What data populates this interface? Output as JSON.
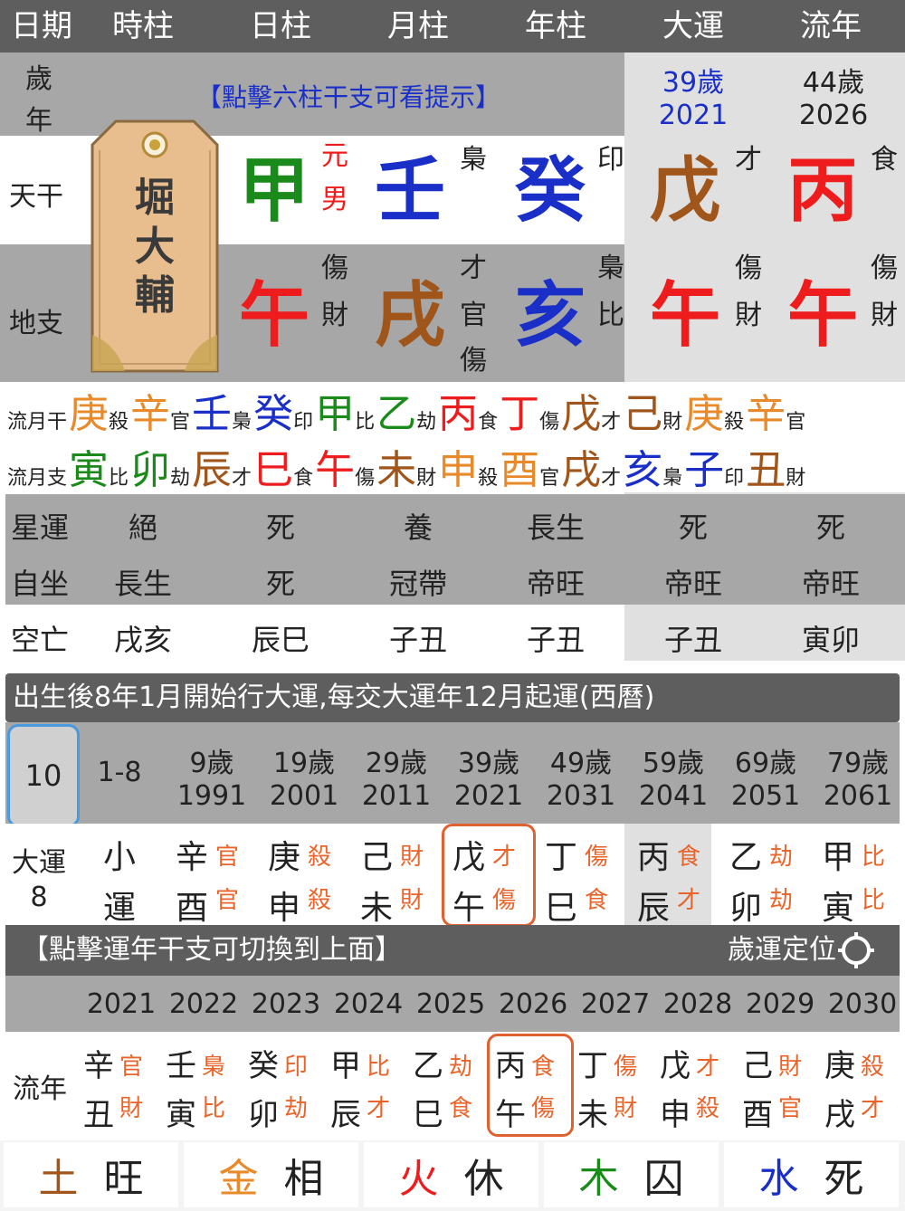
{
  "header": {
    "cols": [
      "日期",
      "時柱",
      "日柱",
      "月柱",
      "年柱",
      "大運",
      "流年"
    ]
  },
  "age_row": {
    "label_top": "歲",
    "label_bottom": "年",
    "hint": "【點擊六柱干支可看提示】",
    "dayun_age": "39歲",
    "dayun_year": "2021",
    "liunian_age": "44歲",
    "liunian_year": "2026"
  },
  "tag": {
    "chars": [
      "堀",
      "大",
      "輔"
    ]
  },
  "tiangan": {
    "label": "天干",
    "day": {
      "char": "甲",
      "color": "#1a8a1a"
    },
    "gender": [
      "元",
      "男"
    ],
    "month": {
      "char": "壬",
      "color": "#1a2fc8"
    },
    "month_ten": "梟",
    "year": {
      "char": "癸",
      "color": "#1a2fc8"
    },
    "year_ten": "印",
    "dayun": {
      "char": "戊",
      "color": "#a0551a"
    },
    "dayun_ten": "才",
    "liunian": {
      "char": "丙",
      "color": "#ee1c1c"
    },
    "liunian_ten": "食"
  },
  "dizhi": {
    "label": "地支",
    "day": {
      "char": "午",
      "color": "#ee1c1c",
      "hidden": [
        "傷",
        "財"
      ]
    },
    "month": {
      "char": "戌",
      "color": "#a0551a",
      "hidden": [
        "才",
        "官",
        "傷"
      ]
    },
    "year": {
      "char": "亥",
      "color": "#1a2fc8",
      "hidden": [
        "梟",
        "比"
      ]
    },
    "dayun": {
      "char": "午",
      "color": "#ee1c1c",
      "hidden": [
        "傷",
        "財"
      ]
    },
    "liunian": {
      "char": "午",
      "color": "#ee1c1c",
      "hidden": [
        "傷",
        "財"
      ]
    }
  },
  "liuyue_gan": {
    "label": "流月干",
    "items": [
      {
        "g": "庚",
        "t": "殺",
        "c": "#e8892a"
      },
      {
        "g": "辛",
        "t": "官",
        "c": "#e8892a"
      },
      {
        "g": "壬",
        "t": "梟",
        "c": "#1a2fc8"
      },
      {
        "g": "癸",
        "t": "印",
        "c": "#1a2fc8"
      },
      {
        "g": "甲",
        "t": "比",
        "c": "#1a8a1a"
      },
      {
        "g": "乙",
        "t": "劫",
        "c": "#1a8a1a"
      },
      {
        "g": "丙",
        "t": "食",
        "c": "#ee1c1c"
      },
      {
        "g": "丁",
        "t": "傷",
        "c": "#ee1c1c"
      },
      {
        "g": "戊",
        "t": "才",
        "c": "#a0551a"
      },
      {
        "g": "己",
        "t": "財",
        "c": "#a0551a"
      },
      {
        "g": "庚",
        "t": "殺",
        "c": "#e8892a"
      },
      {
        "g": "辛",
        "t": "官",
        "c": "#e8892a"
      }
    ]
  },
  "liuyue_zhi": {
    "label": "流月支",
    "items": [
      {
        "g": "寅",
        "t": "比",
        "c": "#1a8a1a"
      },
      {
        "g": "卯",
        "t": "劫",
        "c": "#1a8a1a"
      },
      {
        "g": "辰",
        "t": "才",
        "c": "#a0551a"
      },
      {
        "g": "巳",
        "t": "食",
        "c": "#ee1c1c"
      },
      {
        "g": "午",
        "t": "傷",
        "c": "#ee1c1c"
      },
      {
        "g": "未",
        "t": "財",
        "c": "#a0551a"
      },
      {
        "g": "申",
        "t": "殺",
        "c": "#e8892a"
      },
      {
        "g": "酉",
        "t": "官",
        "c": "#e8892a"
      },
      {
        "g": "戌",
        "t": "才",
        "c": "#a0551a"
      },
      {
        "g": "亥",
        "t": "梟",
        "c": "#1a2fc8"
      },
      {
        "g": "子",
        "t": "印",
        "c": "#1a2fc8"
      },
      {
        "g": "丑",
        "t": "財",
        "c": "#a0551a"
      }
    ]
  },
  "xingyun": {
    "label": "星運",
    "vals": [
      "絕",
      "死",
      "養",
      "長生",
      "死",
      "死"
    ]
  },
  "zizuo": {
    "label": "自坐",
    "vals": [
      "長生",
      "死",
      "冠帶",
      "帝旺",
      "帝旺",
      "帝旺"
    ]
  },
  "kongwang": {
    "label": "空亡",
    "vals": [
      "戌亥",
      "辰巳",
      "子丑",
      "子丑",
      "子丑",
      "寅卯"
    ]
  },
  "dayun_bar": {
    "text": "出生後8年1月開始行大運,每交大運年12月起運(西曆)"
  },
  "dayun_ages": {
    "selected": "10",
    "range": "1-8",
    "cols": [
      {
        "age": "9歲",
        "year": "1991"
      },
      {
        "age": "19歲",
        "year": "2001"
      },
      {
        "age": "29歲",
        "year": "2011"
      },
      {
        "age": "39歲",
        "year": "2021"
      },
      {
        "age": "49歲",
        "year": "2031"
      },
      {
        "age": "59歲",
        "year": "2041"
      },
      {
        "age": "69歲",
        "year": "2051"
      },
      {
        "age": "79歲",
        "year": "2061"
      }
    ]
  },
  "dayun_pillars": {
    "label": "大運",
    "label_num": "8",
    "small": [
      "小",
      "運"
    ],
    "cols": [
      {
        "g": "辛",
        "gt": "官",
        "z": "酉",
        "zt": "官"
      },
      {
        "g": "庚",
        "gt": "殺",
        "z": "申",
        "zt": "殺"
      },
      {
        "g": "己",
        "gt": "財",
        "z": "未",
        "zt": "財"
      },
      {
        "g": "戊",
        "gt": "才",
        "z": "午",
        "zt": "傷"
      },
      {
        "g": "丁",
        "gt": "傷",
        "z": "巳",
        "zt": "食"
      },
      {
        "g": "丙",
        "gt": "食",
        "z": "辰",
        "zt": "才"
      },
      {
        "g": "乙",
        "gt": "劫",
        "z": "卯",
        "zt": "劫"
      },
      {
        "g": "甲",
        "gt": "比",
        "z": "寅",
        "zt": "比"
      }
    ]
  },
  "switch_bar": {
    "text": "【點擊運年干支可切換到上面】",
    "locate": "歲運定位"
  },
  "liunian_years": [
    "2021",
    "2022",
    "2023",
    "2024",
    "2025",
    "2026",
    "2027",
    "2028",
    "2029",
    "2030"
  ],
  "liunian_pillars": {
    "label": "流年",
    "cols": [
      {
        "g": "辛",
        "gt": "官",
        "z": "丑",
        "zt": "財"
      },
      {
        "g": "壬",
        "gt": "梟",
        "z": "寅",
        "zt": "比"
      },
      {
        "g": "癸",
        "gt": "印",
        "z": "卯",
        "zt": "劫"
      },
      {
        "g": "甲",
        "gt": "比",
        "z": "辰",
        "zt": "才"
      },
      {
        "g": "乙",
        "gt": "劫",
        "z": "巳",
        "zt": "食"
      },
      {
        "g": "丙",
        "gt": "食",
        "z": "午",
        "zt": "傷"
      },
      {
        "g": "丁",
        "gt": "傷",
        "z": "未",
        "zt": "財"
      },
      {
        "g": "戊",
        "gt": "才",
        "z": "申",
        "zt": "殺"
      },
      {
        "g": "己",
        "gt": "財",
        "z": "酉",
        "zt": "官"
      },
      {
        "g": "庚",
        "gt": "殺",
        "z": "戌",
        "zt": "才"
      }
    ]
  },
  "wuxing_state": [
    {
      "el": "土",
      "state": "旺",
      "c": "#a0551a"
    },
    {
      "el": "金",
      "state": "相",
      "c": "#e8892a"
    },
    {
      "el": "火",
      "state": "休",
      "c": "#ee1c1c"
    },
    {
      "el": "木",
      "state": "囚",
      "c": "#1a8a1a"
    },
    {
      "el": "水",
      "state": "死",
      "c": "#1a2fc8"
    }
  ],
  "colors": {
    "tengod": "#e8642a",
    "header": "#5e5e5e",
    "band": "#a7a7a7",
    "highlight": "#e06030",
    "select": "#4a9ae0"
  }
}
